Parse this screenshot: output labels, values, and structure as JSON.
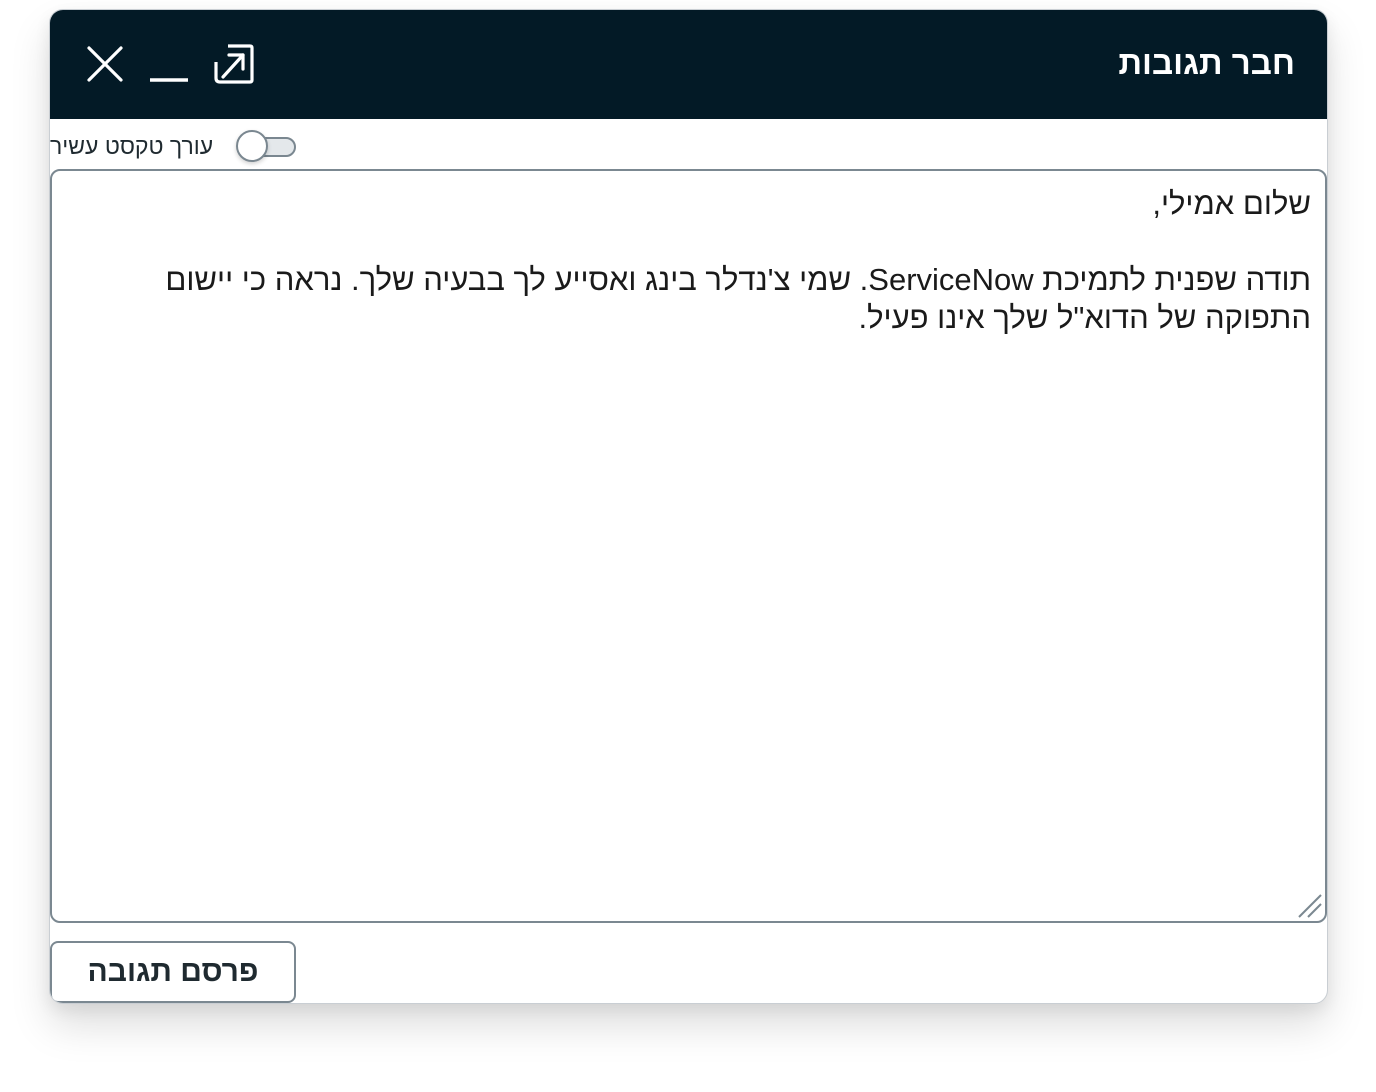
{
  "window": {
    "title": "חבר תגובות",
    "controls": {
      "close_icon": "close-icon",
      "minimize_icon": "minimize-icon",
      "popout_icon": "popout-icon"
    }
  },
  "rich_text_toggle": {
    "label": "עורך טקסט עשיר",
    "enabled": false
  },
  "reply": {
    "greeting": "שלום אמילי,",
    "body": "תודה שפנית לתמיכת ServiceNow. שמי צ'נדלר בינג ואסייע לך בבעיה שלך. נראה כי יישום התפוקה של הדוא\"ל שלך אינו פעיל."
  },
  "actions": {
    "post_label": "פרסם תגובה"
  },
  "colors": {
    "titlebar_bg": "#031a26",
    "title_text": "#ffffff",
    "border": "#7b8891"
  }
}
